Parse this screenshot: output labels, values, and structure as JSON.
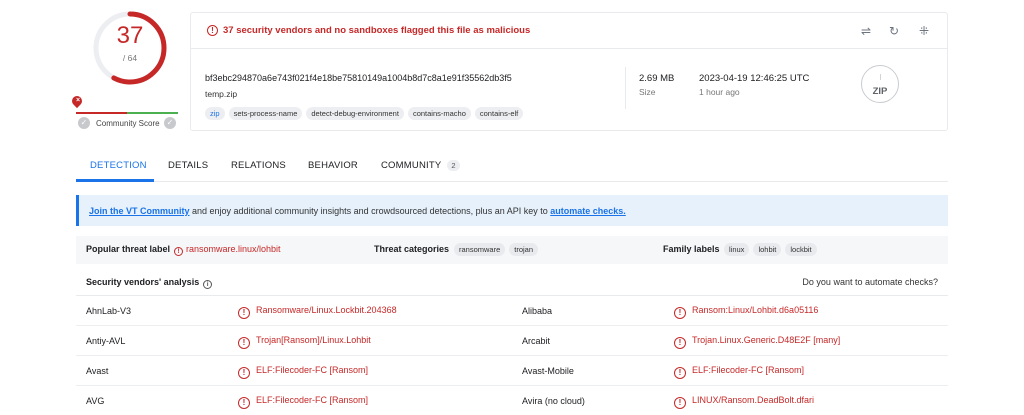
{
  "score": {
    "detections": "37",
    "total": "/ 64",
    "community_label": "Community Score",
    "pin_glyph": "×",
    "vote_down_glyph": "✓",
    "vote_up_glyph": "✓"
  },
  "summary": {
    "alert_text": "37 security vendors and no sandboxes flagged this file as malicious",
    "alert_glyph": "!",
    "hash": "bf3ebc294870a6e743f021f4e18be75810149a1004b8d7c8a1e91f35562db3f5",
    "filename": "temp.zip",
    "tags": [
      "zip",
      "sets-process-name",
      "detect-debug-environment",
      "contains-macho",
      "contains-elf"
    ],
    "size_value": "2.69 MB",
    "size_label": "Size",
    "date_value": "2023-04-19 12:46:25 UTC",
    "date_label": "1 hour ago",
    "file_type": "ZIP",
    "file_zip_glyph": "⁝",
    "tools": {
      "compare_glyph": "⇌",
      "reanalyze_glyph": "↻",
      "similar_glyph": "⁜"
    }
  },
  "tabs": [
    {
      "label": "DETECTION",
      "active": true
    },
    {
      "label": "DETAILS"
    },
    {
      "label": "RELATIONS"
    },
    {
      "label": "BEHAVIOR"
    },
    {
      "label": "COMMUNITY",
      "count": "2"
    }
  ],
  "banner": {
    "join_link": "Join the VT Community",
    "middle_text": " and enjoy additional community insights and crowdsourced detections, plus an API key to ",
    "automate_link": "automate checks."
  },
  "threat": {
    "popular_label": "Popular threat label",
    "popular_value": "ransomware.linux/lohbit",
    "categories_label": "Threat categories",
    "categories": [
      "ransomware",
      "trojan"
    ],
    "family_label": "Family labels",
    "families": [
      "linux",
      "lohbit",
      "lockbit"
    ]
  },
  "vendors": {
    "title": "Security vendors' analysis",
    "automate_prompt": "Do you want to automate checks?",
    "info_glyph": "i",
    "result_glyph": "!",
    "rows": [
      {
        "left_name": "AhnLab-V3",
        "left_result": "Ransomware/Linux.Lockbit.204368",
        "right_name": "Alibaba",
        "right_result": "Ransom:Linux/Lohbit.d6a05116"
      },
      {
        "left_name": "Antiy-AVL",
        "left_result": "Trojan[Ransom]/Linux.Lohbit",
        "right_name": "Arcabit",
        "right_result": "Trojan.Linux.Generic.D48E2F [many]"
      },
      {
        "left_name": "Avast",
        "left_result": "ELF:Filecoder-FC [Ransom]",
        "right_name": "Avast-Mobile",
        "right_result": "ELF:Filecoder-FC [Ransom]"
      },
      {
        "left_name": "AVG",
        "left_result": "ELF:Filecoder-FC [Ransom]",
        "right_name": "Avira (no cloud)",
        "right_result": "LINUX/Ransom.DeadBolt.dfari"
      }
    ]
  },
  "colors": {
    "danger": "#c62828",
    "accent": "#1a73e8",
    "safe": "#4caf50"
  }
}
